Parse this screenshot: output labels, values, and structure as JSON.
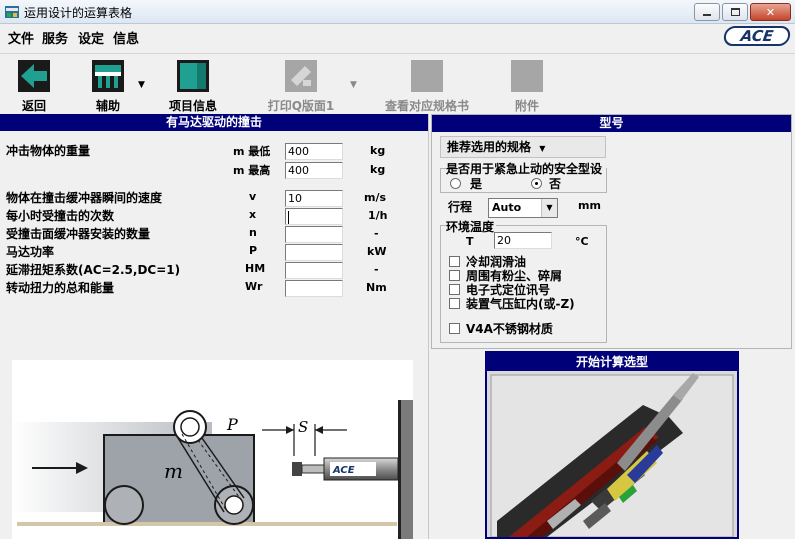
{
  "window": {
    "title": "运用设计的运算表格",
    "icon": "app-icon"
  },
  "window_controls": [
    {
      "name": "minimize",
      "glyph": "▬"
    },
    {
      "name": "restore",
      "glyph": "❐"
    },
    {
      "name": "close",
      "glyph": "✕"
    }
  ],
  "menu": [
    "文件",
    "服务",
    "设定",
    "信息"
  ],
  "brand": {
    "logo_text": "ACE",
    "color": "#17336b"
  },
  "toolbar": {
    "back": "返回",
    "assist": "辅助",
    "project_info": "项目信息",
    "print": "打印Q版面1",
    "view_spec": "查看对应规格书",
    "attachment": "附件"
  },
  "left_panel": {
    "header": "有马达驱动的撞击",
    "rows": [
      {
        "label": "冲击物体的重量",
        "symbol": "m 最低",
        "value": "400",
        "unit": "kg"
      },
      {
        "label": "",
        "symbol": "m 最高",
        "value": "400",
        "unit": "kg"
      },
      {
        "label": "物体在撞击缓冲器瞬间的速度",
        "symbol": "v",
        "value": "10",
        "unit": "m/s"
      },
      {
        "label": "每小时受撞击的次数",
        "symbol": "x",
        "value": "",
        "unit": "1/h"
      },
      {
        "label": "受撞击面缓冲器安装的数量",
        "symbol": "n",
        "value": "",
        "unit": "-"
      },
      {
        "label": "马达功率",
        "symbol": "P",
        "value": "",
        "unit": "kW"
      },
      {
        "label": "延滞扭矩系数(AC=2.5,DC=1)",
        "symbol": "HM",
        "value": "",
        "unit": "-"
      },
      {
        "label": "转动扭力的总和能量",
        "symbol": "Wr",
        "value": "",
        "unit": "Nm"
      }
    ],
    "diagram": {
      "label_p": "P",
      "label_s": "S",
      "label_m": "m",
      "shock_brand": "ACE"
    }
  },
  "right_panel": {
    "header": "型号",
    "recommend_dropdown": "推荐选用的规格",
    "safety_question": "是否用于紧急止动的安全型设",
    "safety_yes": "是",
    "safety_no": "否",
    "safety_selected": "no",
    "stroke_label": "行程",
    "stroke_value": "Auto",
    "stroke_unit": "mm",
    "env_title": "环境温度",
    "temp_symbol": "T",
    "temp_value": "20",
    "temp_unit": "°C",
    "options": [
      "冷却润滑油",
      "周围有粉尘、碎屑",
      "电子式定位讯号",
      "装置气压缸内(或-Z)"
    ],
    "v4a": "V4A不锈钢材质",
    "calc_button": "开始计算选型"
  }
}
